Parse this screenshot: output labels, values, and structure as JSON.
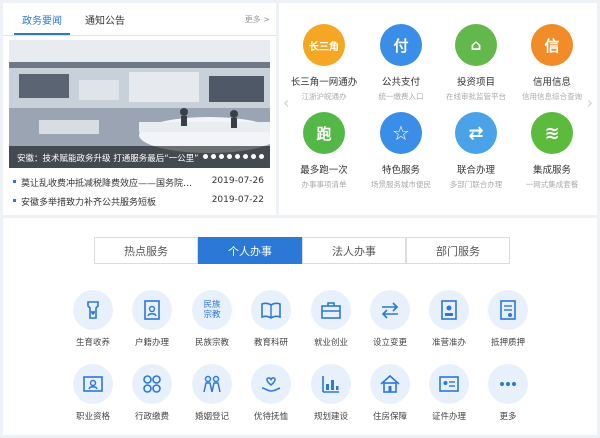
{
  "news": {
    "tabs": [
      "政务要闻",
      "通知公告"
    ],
    "more": "更多 >",
    "slide_caption": "安徽：技术赋能政务升级 打通服务最后“一公里”",
    "slide_dot_count": 8,
    "items": [
      {
        "title": "莫让乱收费冲抵减税降费效应——国务院…",
        "date": "2019-07-26"
      },
      {
        "title": "安徽多举措致力补齐公共服务短板",
        "date": "2019-07-22"
      }
    ]
  },
  "services": [
    {
      "name": "长三角一网通办",
      "sub": "江浙沪皖通办",
      "icon": "yangtze-delta-icon",
      "glyph": "长三角",
      "color": "#f5a623"
    },
    {
      "name": "公共支付",
      "sub": "统一缴费入口",
      "icon": "payment-icon",
      "glyph": "付",
      "color": "#3b8ee8"
    },
    {
      "name": "投资项目",
      "sub": "在线审批监管平台",
      "icon": "investment-icon",
      "glyph": "⌂",
      "color": "#62b84a"
    },
    {
      "name": "信用信息",
      "sub": "信用信息综合查询",
      "icon": "credit-icon",
      "glyph": "信",
      "color": "#f28c28"
    },
    {
      "name": "最多跑一次",
      "sub": "办事事项清单",
      "icon": "run-once-icon",
      "glyph": "跑",
      "color": "#54b848"
    },
    {
      "name": "特色服务",
      "sub": "场景服务城市便民",
      "icon": "star-service-icon",
      "glyph": "☆",
      "color": "#3b8ee8"
    },
    {
      "name": "联合办理",
      "sub": "多部门联合办理",
      "icon": "joint-handling-icon",
      "glyph": "⇄",
      "color": "#4aa3e8"
    },
    {
      "name": "集成服务",
      "sub": "一网式集成套餐",
      "icon": "integrated-service-icon",
      "glyph": "≋",
      "color": "#5cba3c"
    }
  ],
  "bottom_tabs": [
    "热点服务",
    "个人办事",
    "法人办事",
    "部门服务"
  ],
  "active_tab_index": 1,
  "personal_items": [
    {
      "label": "生育收养",
      "icon": "birth-adoption-icon"
    },
    {
      "label": "户籍办理",
      "icon": "household-register-icon"
    },
    {
      "label": "民族宗教",
      "icon": "ethnic-religion-icon",
      "glyph": "民族\n宗教"
    },
    {
      "label": "教育科研",
      "icon": "education-icon"
    },
    {
      "label": "就业创业",
      "icon": "employment-icon"
    },
    {
      "label": "设立变更",
      "icon": "establish-change-icon"
    },
    {
      "label": "准营准办",
      "icon": "permit-icon"
    },
    {
      "label": "抵押质押",
      "icon": "mortgage-icon"
    },
    {
      "label": "职业资格",
      "icon": "qualification-icon"
    },
    {
      "label": "行政缴费",
      "icon": "admin-fee-icon"
    },
    {
      "label": "婚姻登记",
      "icon": "marriage-icon"
    },
    {
      "label": "优待抚恤",
      "icon": "pension-icon"
    },
    {
      "label": "规划建设",
      "icon": "planning-icon"
    },
    {
      "label": "住房保障",
      "icon": "housing-icon"
    },
    {
      "label": "证件办理",
      "icon": "certificate-icon"
    },
    {
      "label": "更多",
      "icon": "more-icon"
    }
  ],
  "colors": {
    "accent": "#2b78d6",
    "icon_bg": "#e8f1fb"
  }
}
